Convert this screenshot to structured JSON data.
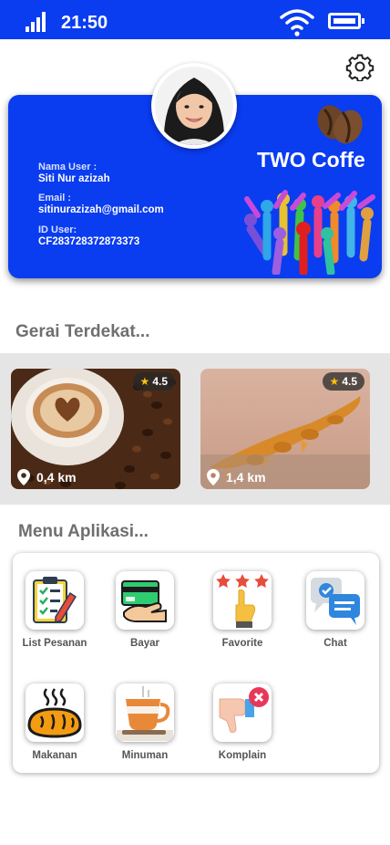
{
  "status_bar": {
    "time": "21:50",
    "signal_icon": "signal-bars-icon",
    "wifi_icon": "wifi-icon",
    "battery_icon": "battery-icon",
    "background": "#0a3cf0"
  },
  "header": {
    "settings_icon": "gear-icon"
  },
  "profile": {
    "name_label": "Nama User :",
    "name": "Siti Nur azizah",
    "email_label": "Email :",
    "email": "sitinurazizah@gmail.com",
    "id_label": "ID User:",
    "id": "CF283728372873373",
    "brand": "TWO Coffe",
    "brand_icon": "coffee-beans-icon",
    "card_color": "#0a3cf0"
  },
  "stores": {
    "title": "Gerai Terdekat...",
    "items": [
      {
        "rating": "4.5",
        "distance": "0,4 km",
        "image": "latte-art-coffee-photo"
      },
      {
        "rating": "4.5",
        "distance": "1,4 km",
        "image": "croissant-bread-photo"
      }
    ]
  },
  "menu": {
    "title": "Menu Aplikasi...",
    "items": [
      {
        "label": "List Pesanan",
        "icon": "checklist-icon"
      },
      {
        "label": "Bayar",
        "icon": "payment-card-icon"
      },
      {
        "label": "Favorite",
        "icon": "favorite-stars-icon"
      },
      {
        "label": "Chat",
        "icon": "chat-bubbles-icon"
      },
      {
        "label": "Makanan",
        "icon": "bread-icon"
      },
      {
        "label": "Minuman",
        "icon": "coffee-cup-icon"
      },
      {
        "label": "Komplain",
        "icon": "thumbs-down-icon"
      }
    ]
  }
}
